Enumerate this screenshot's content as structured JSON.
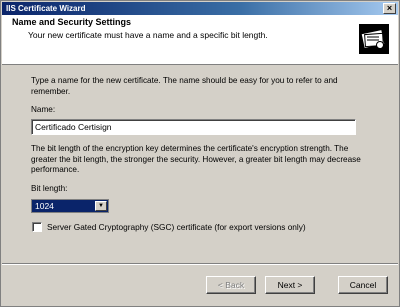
{
  "window": {
    "title": "IIS Certificate Wizard",
    "close_glyph": "×"
  },
  "header": {
    "title": "Name and Security Settings",
    "subtitle": "Your new certificate must have a name and a specific bit length.",
    "icon": "certificate-wizard-icon"
  },
  "content": {
    "intro": "Type a name for the new certificate. The name should be easy for you to refer to and remember.",
    "name_label": "Name:",
    "name_value": "Certificado Certisign",
    "bit_info": "The bit length of the encryption key determines the certificate's encryption strength. The greater the bit length, the stronger the security.  However, a greater bit length may decrease performance.",
    "bit_label": "Bit length:",
    "bit_value": "1024",
    "sgc_label": "Server Gated Cryptography (SGC) certificate (for export versions only)",
    "sgc_checked": false
  },
  "buttons": {
    "back": "< Back",
    "next": "Next >",
    "cancel": "Cancel"
  }
}
